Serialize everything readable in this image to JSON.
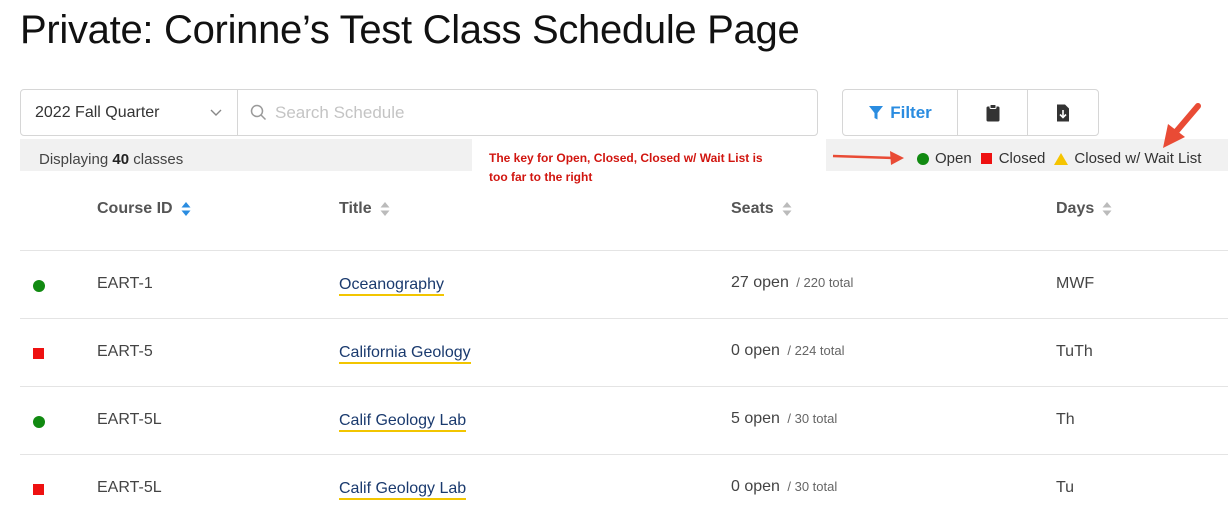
{
  "page": {
    "title": "Private: Corinne’s Test Class Schedule Page"
  },
  "toolbar": {
    "term": "2022 Fall Quarter",
    "search_placeholder": "Search Schedule",
    "filter_label": "Filter"
  },
  "info": {
    "count_prefix": "Displaying ",
    "count": "40",
    "count_suffix": " classes",
    "annotation_line1": "The key for Open, Closed, Closed w/ Wait List is",
    "annotation_line2": "too far to the right"
  },
  "legend": {
    "open": "Open",
    "closed": "Closed",
    "waitlist": "Closed w/ Wait List"
  },
  "table": {
    "headers": {
      "course_id": "Course ID",
      "title": "Title",
      "seats": "Seats",
      "days": "Days"
    },
    "rows": [
      {
        "status": "open",
        "course_id": "EART-1",
        "title": "Oceanography",
        "seats_open": "27 open",
        "seats_total": "/ 220 total",
        "days": "MWF"
      },
      {
        "status": "closed",
        "course_id": "EART-5",
        "title": "California Geology",
        "seats_open": "0 open",
        "seats_total": "/ 224 total",
        "days": "TuTh"
      },
      {
        "status": "open",
        "course_id": "EART-5L",
        "title": "Calif Geology Lab",
        "seats_open": "5 open",
        "seats_total": "/ 30 total",
        "days": "Th"
      },
      {
        "status": "closed",
        "course_id": "EART-5L",
        "title": "Calif Geology Lab",
        "seats_open": "0 open",
        "seats_total": "/ 30 total",
        "days": "Tu"
      }
    ]
  },
  "colors": {
    "open": "#118a11",
    "closed": "#ee1111",
    "waitlist": "#f5c400",
    "accent": "#2a8ce0",
    "annotation": "#d1150f",
    "link": "#1a3a6e"
  }
}
